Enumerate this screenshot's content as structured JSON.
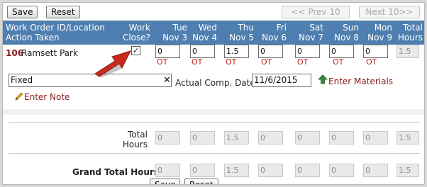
{
  "toolbar": {
    "save": "Save",
    "reset": "Reset",
    "prev": "<< Prev 10",
    "next": "Next 10>>"
  },
  "header": {
    "left_line1": "Work Order ID/Location",
    "left_line2": "Action Taken",
    "work_close": [
      "Work",
      "Close?"
    ],
    "days": [
      {
        "day": "Tue",
        "date": "Nov 3"
      },
      {
        "day": "Wed",
        "date": "Nov 4"
      },
      {
        "day": "Thu",
        "date": "Nov 5"
      },
      {
        "day": "Fri",
        "date": "Nov 6"
      },
      {
        "day": "Sat",
        "date": "Nov 7"
      },
      {
        "day": "Sun",
        "date": "Nov 8"
      },
      {
        "day": "Mon",
        "date": "Nov 9"
      }
    ],
    "total": [
      "Total",
      "Hours"
    ]
  },
  "work_order": {
    "id": "106",
    "location": "Ramsett Park",
    "work_close_checked": true,
    "check_mark": "✓",
    "hours": [
      "0",
      "0",
      "1.5",
      "0",
      "0",
      "0",
      "0"
    ],
    "total_hours": "1.5",
    "ot_label": "OT",
    "action_taken": "Fixed",
    "clear_label": "✕",
    "actual_comp_date_label": "Actual Comp. Date",
    "actual_comp_date": "11/6/2015",
    "enter_materials": "Enter Materials",
    "enter_note": "Enter Note"
  },
  "totals": {
    "label_line1": "Total",
    "label_line2": "Hours",
    "hours": [
      "0",
      "0",
      "1.5",
      "0",
      "0",
      "0",
      "0"
    ],
    "total": "1.5"
  },
  "grand_totals": {
    "label": "Grand Total Hours",
    "hours": [
      "0",
      "0",
      "1.5",
      "0",
      "0",
      "0",
      "0"
    ],
    "total": "1.5"
  },
  "icons": {
    "materials": "green-arrow-icon",
    "note": "pencil-icon",
    "pointer": "red-arrow-icon"
  },
  "colors": {
    "header_bg": "#4f7fb0",
    "ot": "#c0241b",
    "link": "#8b1a1a",
    "pointer": "#c8281f"
  }
}
